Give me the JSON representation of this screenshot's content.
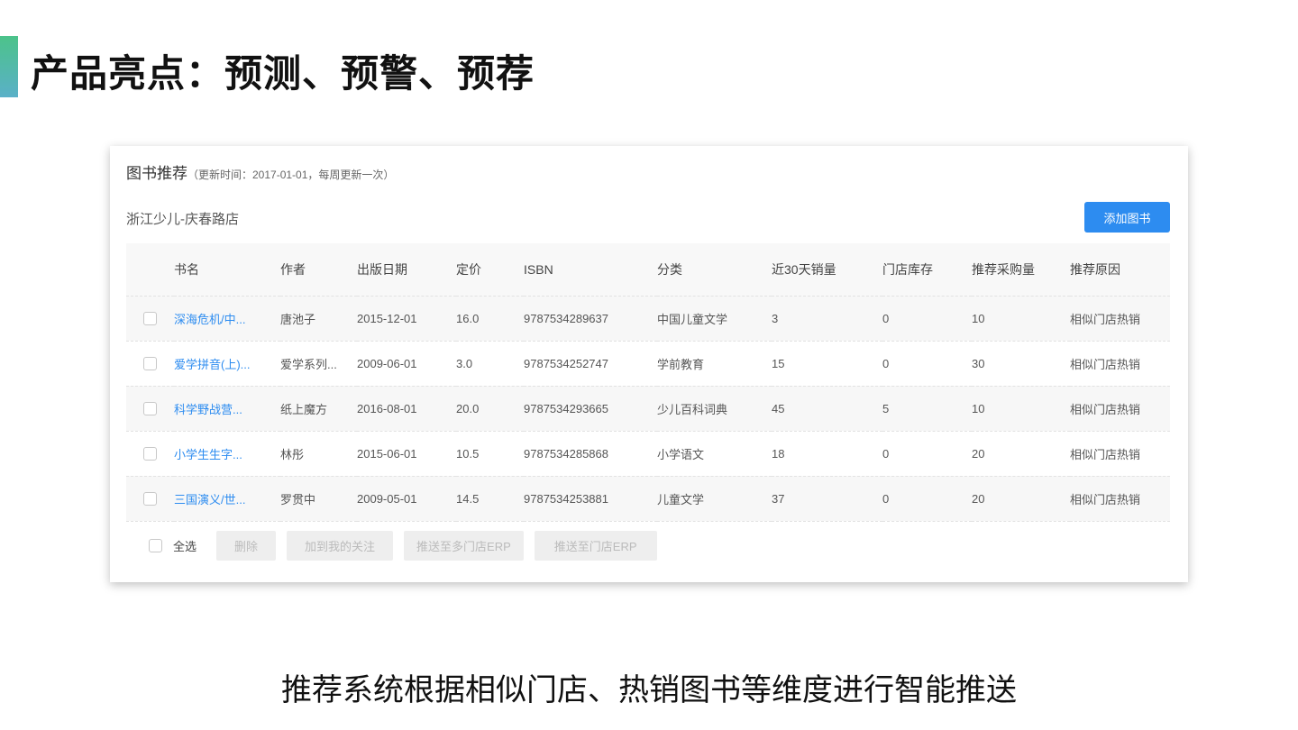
{
  "slide": {
    "title": "产品亮点：预测、预警、预荐",
    "caption": "推荐系统根据相似门店、热销图书等维度进行智能推送",
    "accent_color": "#4cc38a"
  },
  "card": {
    "title": "图书推荐",
    "subtitle": "（更新时间：2017-01-01，每周更新一次）",
    "store": "浙江少儿-庆春路店",
    "add_button": "添加图书"
  },
  "table": {
    "headers": [
      "书名",
      "作者",
      "出版日期",
      "定价",
      "ISBN",
      "分类",
      "近30天销量",
      "门店库存",
      "推荐采购量",
      "推荐原因"
    ],
    "rows": [
      [
        "深海危机/中...",
        "唐池子",
        "2015-12-01",
        "16.0",
        "9787534289637",
        "中国儿童文学",
        "3",
        "0",
        "10",
        "相似门店热销"
      ],
      [
        "爱学拼音(上)...",
        "爱学系列...",
        "2009-06-01",
        "3.0",
        "9787534252747",
        "学前教育",
        "15",
        "0",
        "30",
        "相似门店热销"
      ],
      [
        "科学野战营...",
        "纸上魔方",
        "2016-08-01",
        "20.0",
        "9787534293665",
        "少儿百科词典",
        "45",
        "5",
        "10",
        "相似门店热销"
      ],
      [
        "小学生生字...",
        "林彤",
        "2015-06-01",
        "10.5",
        "9787534285868",
        "小学语文",
        "18",
        "0",
        "20",
        "相似门店热销"
      ],
      [
        "三国演义/世...",
        "罗贯中",
        "2009-05-01",
        "14.5",
        "9787534253881",
        "儿童文学",
        "37",
        "0",
        "20",
        "相似门店热销"
      ]
    ]
  },
  "footer": {
    "select_all": "全选",
    "delete": "删除",
    "follow": "加到我的关注",
    "push_multi": "推送至多门店ERP",
    "push_store": "推送至门店ERP"
  }
}
